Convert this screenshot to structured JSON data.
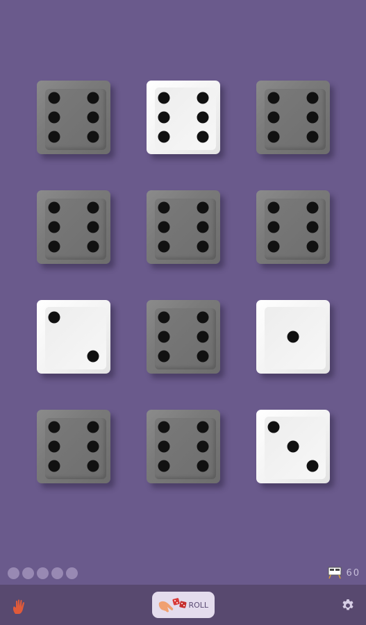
{
  "colors": {
    "background": "#6a5a8c",
    "bottom_bar": "#58496f",
    "held_die": "#7a7a7a",
    "free_die": "#f4f4f4",
    "pip": "#111111",
    "accent": "#e05a3a"
  },
  "dice": [
    {
      "value": 6,
      "held": true
    },
    {
      "value": 6,
      "held": false
    },
    {
      "value": 6,
      "held": true
    },
    {
      "value": 6,
      "held": true
    },
    {
      "value": 6,
      "held": true
    },
    {
      "value": 6,
      "held": true
    },
    {
      "value": 2,
      "held": false
    },
    {
      "value": 6,
      "held": true
    },
    {
      "value": 1,
      "held": false
    },
    {
      "value": 6,
      "held": true
    },
    {
      "value": 6,
      "held": true
    },
    {
      "value": 3,
      "held": false
    }
  ],
  "rolls_remaining_indicator": {
    "count": 5
  },
  "score": {
    "icon": "scoreboard-icon",
    "value": "60"
  },
  "toolbar": {
    "hand_icon": "hand-icon",
    "roll_label": "ROLL",
    "roll_icon": "hand-dice-icon",
    "settings_icon": "gear-icon"
  }
}
